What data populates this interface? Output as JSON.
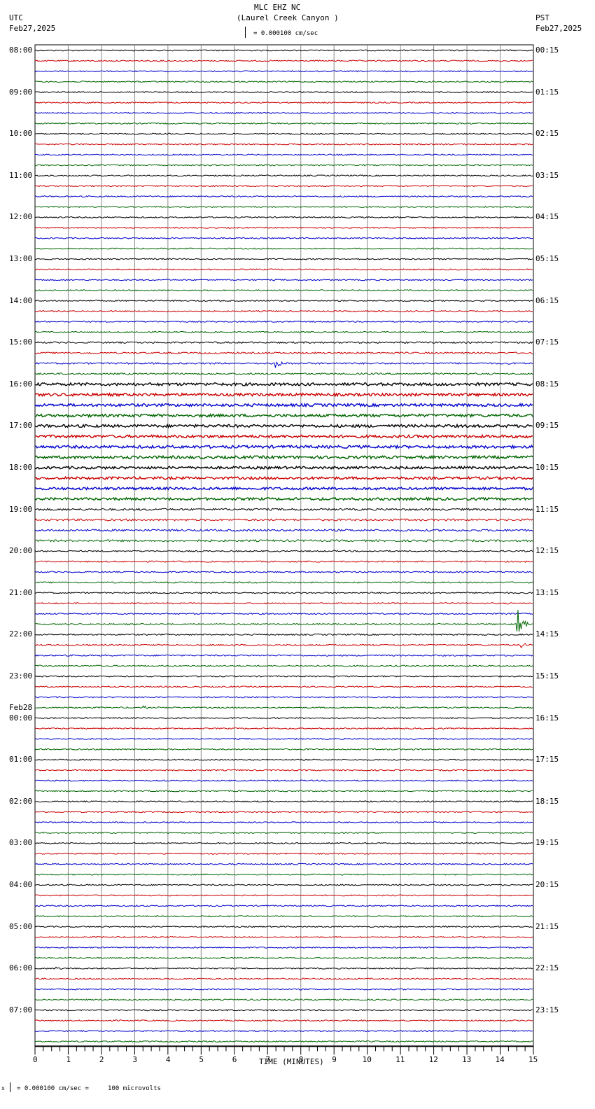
{
  "header": {
    "title": "MLC EHZ NC",
    "subtitle": "(Laurel Creek Canyon )",
    "left_tz": "UTC",
    "left_date": "Feb27,2025",
    "right_tz": "PST",
    "right_date": "Feb27,2025",
    "scale": "= 0.000100 cm/sec"
  },
  "footer": {
    "scale": "= 0.000100 cm/sec =     100 microvolts",
    "mark": "x"
  },
  "chart_data": {
    "type": "line",
    "title": "MLC EHZ NC (Laurel Creek Canyon )",
    "xlabel": "TIME (MINUTES)",
    "xlim": [
      0,
      15
    ],
    "x_ticks": [
      "0",
      "1",
      "2",
      "3",
      "4",
      "5",
      "6",
      "7",
      "8",
      "9",
      "10",
      "11",
      "12",
      "13",
      "14",
      "15"
    ],
    "grid": true,
    "trace_colors": [
      "#000000",
      "#cc0000",
      "#0000cc",
      "#006600"
    ],
    "traces_per_hour": 4,
    "day_change_label": "Feb28",
    "utc_labels": [
      "08:00",
      "09:00",
      "10:00",
      "11:00",
      "12:00",
      "13:00",
      "14:00",
      "15:00",
      "16:00",
      "17:00",
      "18:00",
      "19:00",
      "20:00",
      "21:00",
      "22:00",
      "23:00",
      "00:00",
      "01:00",
      "02:00",
      "03:00",
      "04:00",
      "05:00",
      "06:00",
      "07:00"
    ],
    "pst_labels": [
      "00:15",
      "01:15",
      "02:15",
      "03:15",
      "04:15",
      "05:15",
      "06:15",
      "07:15",
      "08:15",
      "09:15",
      "10:15",
      "11:15",
      "12:15",
      "13:15",
      "14:15",
      "15:15",
      "16:15",
      "17:15",
      "18:15",
      "19:15",
      "20:15",
      "21:15",
      "22:15",
      "23:15"
    ],
    "hourly_noise_level": [
      1,
      1,
      1,
      1,
      1,
      1,
      1,
      1.3,
      2.2,
      2.2,
      2,
      1.6,
      1.1,
      1.1,
      1.1,
      1,
      1,
      1,
      1,
      1,
      1,
      1,
      1,
      1
    ],
    "events": [
      {
        "trace_utc": "15:30",
        "minute": 7.2,
        "amplitude": 14
      },
      {
        "trace_utc": "21:45",
        "minute": 14.5,
        "amplitude": 30
      },
      {
        "trace_utc": "22:15",
        "minute": 14.6,
        "amplitude": 5
      },
      {
        "trace_utc": "23:45",
        "minute": 3.2,
        "amplitude": 4
      },
      {
        "trace_utc": "06:00",
        "minute": 0.6,
        "amplitude": 4
      }
    ]
  }
}
